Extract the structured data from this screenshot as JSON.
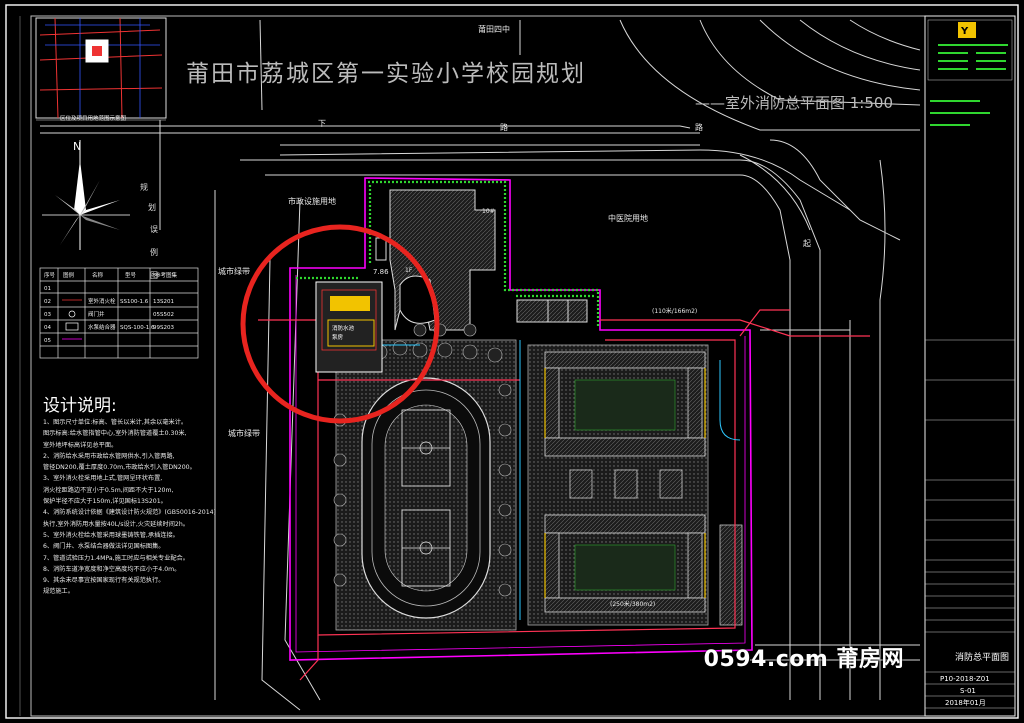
{
  "drawing": {
    "title": "莆田市荔城区第一实验小学校园规划",
    "subtitle": "——室外消防总平面图 1:500",
    "roads": {
      "north_school": "莆田四中",
      "road_a": "路",
      "road_b": "下",
      "road_c": "路",
      "road_d": "路",
      "road_east": "起"
    },
    "labels": {
      "municipal_green": "市政设施用地",
      "city_green_1": "城市绿带",
      "city_green_2": "城市绿带",
      "hospital": "中医院用地",
      "scale_text": "7.86",
      "key_plan_caption": "区位及项目用地范围示意图",
      "building_box_1": "10#",
      "building_box_2": "1F",
      "area_note_1": "(110米/166m2)",
      "area_note_2": "(250米/380m2)",
      "north_mark": "N",
      "compass_label_1": "规",
      "compass_label_2": "划",
      "compass_label_3": "误",
      "compass_label_4": "例",
      "compass_label_5": "图"
    },
    "legend": {
      "headers": [
        "序号",
        "图例",
        "名称",
        "型号",
        "参考图集"
      ],
      "rows": [
        [
          "01",
          "",
          "",
          "",
          ""
        ],
        [
          "02",
          "",
          "室外消火栓",
          "SS100-1.6",
          "13S201"
        ],
        [
          "03",
          "",
          "阀门井",
          "",
          "05S502"
        ],
        [
          "04",
          "",
          "水泵结合器",
          "SQS-100-1.6",
          "99S203"
        ],
        [
          "05",
          "",
          "",
          "",
          ""
        ]
      ]
    },
    "notes": {
      "heading": "设计说明:",
      "lines": [
        "1、图示尺寸单位:标高、管长以米计,其余以毫米计。",
        "图示标高:给水管指管中心,室外消防管道覆土0.30米,",
        "室外地坪标高详见总平面。",
        "2、消防给水采用市政给水管网供水,引入管两路,",
        "管径DN200,覆土厚度0.70m,市政给水引入管DN200。",
        "3、室外消火栓采用地上式,管网呈环状布置,",
        "消火栓距路边不宜小于0.5m,间距不大于120m,",
        "保护半径不应大于150m,详见国标13S201。",
        "4、消防系统设计依据《建筑设计防火规范》(GB50016-2014)",
        "执行,室外消防用水量按40L/s设计,火灾延续时间2h。",
        "5、室外消火栓给水管采用球墨铸铁管,承插连接。",
        "6、阀门井、水泵结合器做法详见国标图集。",
        "7、管道试验压力1.4MPa,施工时应与相关专业配合。",
        "8、消防车道净宽度和净空高度均不应小于4.0m。",
        "9、其余未尽事宜按国家现行有关规范执行。",
        "规范施工。"
      ]
    },
    "titleblock": {
      "drawing_name": "消防总平面图",
      "drawing_no": "P10-2018-Z01",
      "sheet": "S-01",
      "date": "2018年01月"
    },
    "watermark": "0594.com 莆房网",
    "colors": {
      "background": "#000000",
      "site_boundary": "#ff00ff",
      "highlight_circle": "#e8241f",
      "fire_pipe": "#ff3355",
      "hedge_green": "#2fd62f",
      "linework": "#d8d8d8",
      "sheet_border": "#ffffff",
      "cyan": "#2ec9ff",
      "yellow": "#f2c300"
    }
  }
}
